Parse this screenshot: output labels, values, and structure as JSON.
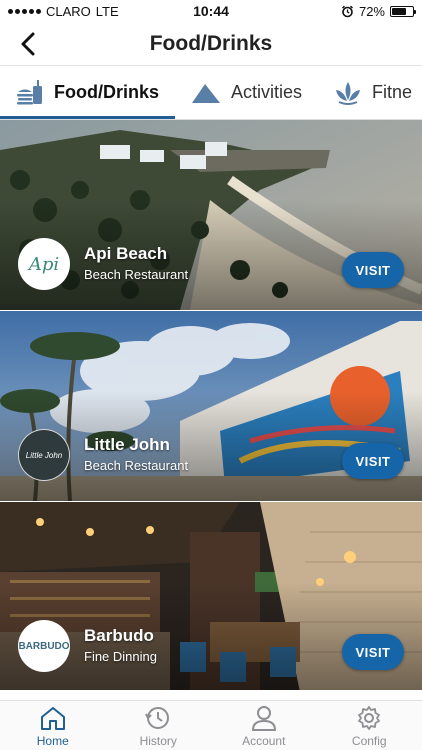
{
  "status": {
    "carrier": "CLARO",
    "network": "LTE",
    "time": "10:44",
    "battery": "72%",
    "battery_level": 0.72
  },
  "nav": {
    "title": "Food/Drinks"
  },
  "tabs": [
    {
      "label": "Food/Drinks",
      "icon": "food-drink-icon",
      "active": true
    },
    {
      "label": "Activities",
      "icon": "mountain-icon",
      "active": false
    },
    {
      "label": "Fitne",
      "icon": "lotus-icon",
      "active": false
    }
  ],
  "cards": [
    {
      "name": "Api Beach",
      "type": "Beach Restaurant",
      "logo_text": "Api",
      "button": "VISIT"
    },
    {
      "name": "Little John",
      "type": "Beach Restaurant",
      "logo_text": "Little John",
      "button": "VISIT"
    },
    {
      "name": "Barbudo",
      "type": "Fine Dinning",
      "logo_text": "BARBUDO",
      "button": "VISIT"
    }
  ],
  "tabbar": [
    {
      "label": "Home",
      "icon": "home-icon",
      "active": true
    },
    {
      "label": "History",
      "icon": "history-icon",
      "active": false
    },
    {
      "label": "Account",
      "icon": "account-icon",
      "active": false
    },
    {
      "label": "Config",
      "icon": "gear-icon",
      "active": false
    }
  ],
  "colors": {
    "accent": "#1f5f96",
    "button": "#1565a8"
  }
}
